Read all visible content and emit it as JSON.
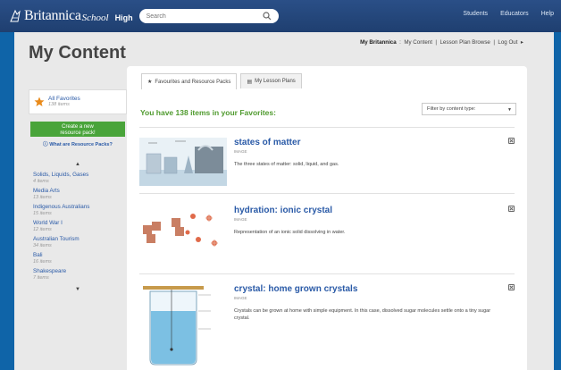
{
  "header": {
    "brand": "Britannica",
    "brand_school": "School",
    "level": "High",
    "search_placeholder": "Search",
    "nav": [
      "Students",
      "Educators",
      "Help"
    ]
  },
  "subnav": {
    "my_britannica": "My Britannica",
    "links": [
      "My Content",
      "Lesson Plan Browse",
      "Log Out"
    ]
  },
  "page_title": "My Content",
  "sidebar": {
    "all_favorites_label": "All Favorites",
    "all_favorites_count": "138 items",
    "create_button_line1": "Create a new",
    "create_button_line2": "resource pack!",
    "what_are_packs": "What are Resource Packs?",
    "packs": [
      {
        "name": "Solids, Liquids, Gases",
        "count": "4 items"
      },
      {
        "name": "Media Arts",
        "count": "13 items"
      },
      {
        "name": "Indigenous Australians",
        "count": "15 items"
      },
      {
        "name": "World War I",
        "count": "12 items"
      },
      {
        "name": "Australian Tourism",
        "count": "34 items"
      },
      {
        "name": "Bali",
        "count": "16 items"
      },
      {
        "name": "Shakespeare",
        "count": "7 items"
      }
    ]
  },
  "tabs": [
    {
      "label": "Favourites and Resource Packs",
      "icon": "star-icon",
      "active": true
    },
    {
      "label": "My Lesson Plans",
      "icon": "list-icon",
      "active": false
    }
  ],
  "main": {
    "count_text": "You have 138 items in your Favorites:",
    "filter_label": "Filter by content type:",
    "items": [
      {
        "title": "states of matter",
        "type": "IMAGE",
        "description": "The three states of matter: solid, liquid, and gas."
      },
      {
        "title": "hydration: ionic crystal",
        "type": "IMAGE",
        "description": "Representation of an ionic solid dissolving in water."
      },
      {
        "title": "crystal: home grown crystals",
        "type": "IMAGE",
        "description": "Crystals can be grown at home with simple equipment. In this case, dissolved sugar molecules settle onto a tiny sugar crystal."
      }
    ]
  },
  "colors": {
    "header_bg": "#1f3f70",
    "link_blue": "#2a5aa7",
    "green": "#4f9a2e",
    "button_green": "#49a43a",
    "background": "#0f64a8"
  }
}
